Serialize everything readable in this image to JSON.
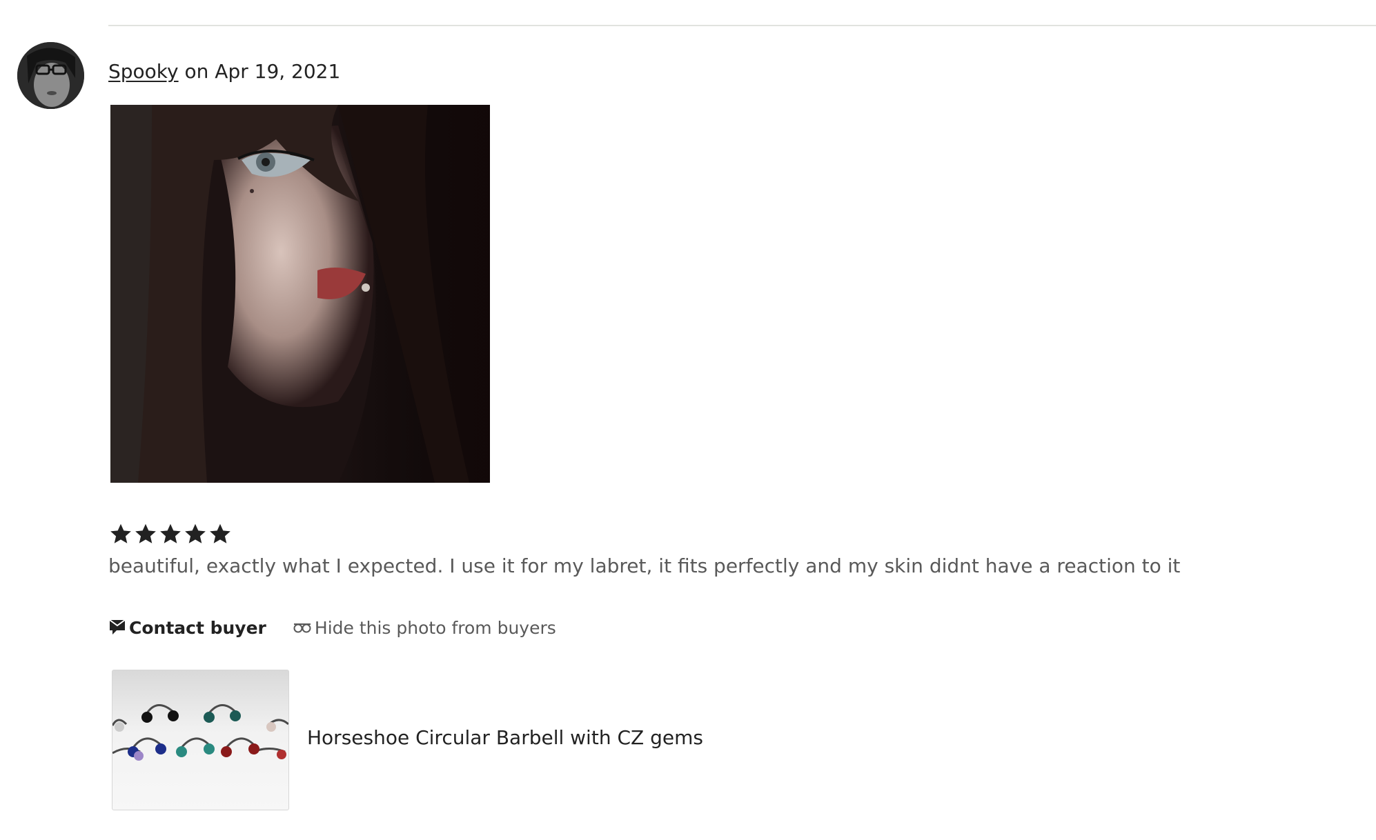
{
  "review": {
    "reviewer_name": "Spooky",
    "date_text": " on Apr 19, 2021",
    "rating": 5,
    "rating_max": 5,
    "text": "beautiful, exactly what I expected. I use it for my labret, it fits perfectly and my skin didnt have a reaction to it"
  },
  "actions": {
    "contact_label": "Contact buyer",
    "contact_icon": "speech-bubble-icon",
    "hide_label": "Hide this photo from buyers",
    "hide_icon": "hidden-eyes-icon"
  },
  "product": {
    "title": "Horseshoe Circular Barbell with CZ gems"
  },
  "colors": {
    "text": "#222222",
    "muted_text": "#595959",
    "divider": "#e1e3df",
    "star": "#222222"
  }
}
